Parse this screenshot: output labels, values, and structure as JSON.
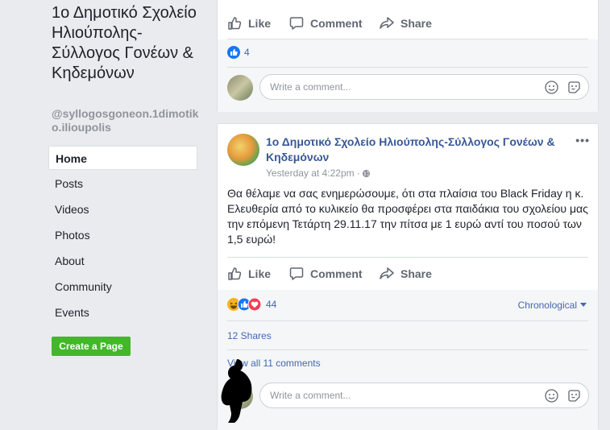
{
  "sidebar": {
    "page_name": "1ο Δημοτικό Σχολείο Ηλιούπολης-Σύλλογος Γονέων & Κηδεμόνων",
    "username": "@syllogosgoneon.1dimotiko.ilioupolis",
    "nav": [
      {
        "label": "Home",
        "active": true
      },
      {
        "label": "Posts"
      },
      {
        "label": "Videos"
      },
      {
        "label": "Photos"
      },
      {
        "label": "About"
      },
      {
        "label": "Community"
      },
      {
        "label": "Events"
      }
    ],
    "create_page_label": "Create a Page"
  },
  "post1": {
    "like_label": "Like",
    "comment_label": "Comment",
    "share_label": "Share",
    "reaction_count": "4",
    "comment_placeholder": "Write a comment..."
  },
  "post2": {
    "author": "1ο Δημοτικό Σχολείο Ηλιούπολης-Σύλλογος Γονέων & Κηδεμόνων",
    "time": "Yesterday at 4:22pm · ",
    "text": "Θα θέλαμε να σας ενημερώσουμε, ότι στα πλαίσια του Black Friday η κ. Ελευθερία από το κυλικείο θα προσφέρει στα παιδάκια του σχολείου μας την επόμενη Τετάρτη 29.11.17 την πίτσα με 1 ευρώ αντί του ποσού των 1,5 ευρώ!",
    "like_label": "Like",
    "comment_label": "Comment",
    "share_label": "Share",
    "reaction_count": "44",
    "sort_label": "Chronological",
    "shares_label": "12 Shares",
    "view_all_label": "View all 11 comments",
    "comment_placeholder": "Write a comment..."
  },
  "colors": {
    "background": "#e9ebee",
    "link_blue": "#4267b2",
    "author_blue": "#385898",
    "create_green": "#42b72a"
  }
}
